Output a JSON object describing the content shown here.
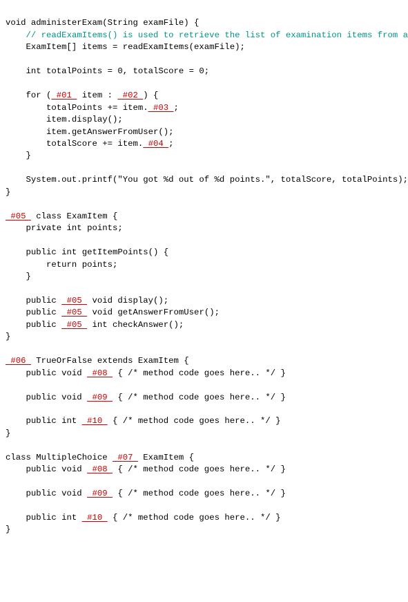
{
  "blanks": {
    "b01": " #01 ",
    "b02": " #02 ",
    "b03": " #03 ",
    "b04": " #04 ",
    "b05": " #05 ",
    "b06": " #06 ",
    "b07": " #07 ",
    "b08": " #08 ",
    "b09": " #09 ",
    "b10": " #10 "
  },
  "code": {
    "l00a": "void administerExam(String examFile) {",
    "l01a": "    ",
    "l01b": "// readExamItems() is used to retrieve the list of examination items from a file...",
    "l02a": "    ExamItem[] items = readExamItems(examFile);",
    "l04a": "    int totalPoints = 0, totalScore = 0;",
    "l06a": "    for (",
    "l06b": " item : ",
    "l06c": ") {",
    "l07a": "        totalPoints += item.",
    "l07b": ";",
    "l08a": "        item.display();",
    "l09a": "        item.getAnswerFromUser();",
    "l10a": "        totalScore += item.",
    "l10b": ";",
    "l11a": "    }",
    "l13a": "    System.out.printf(\"You got %d out of %d points.\", totalScore, totalPoints);",
    "l14a": "}",
    "l16a": " class ExamItem {",
    "l17a": "    private int points;",
    "l19a": "    public int getItemPoints() {",
    "l20a": "        return points;",
    "l21a": "    }",
    "l23a": "    public ",
    "l23b": " void display();",
    "l24a": "    public ",
    "l24b": " void getAnswerFromUser();",
    "l25a": "    public ",
    "l25b": " int checkAnswer();",
    "l26a": "}",
    "l28a": " TrueOrFalse extends ExamItem {",
    "l29a": "    public void ",
    "l29b": " { /* method code goes here.. */ }",
    "l31a": "    public void ",
    "l31b": " { /* method code goes here.. */ }",
    "l33a": "    public int ",
    "l33b": " { /* method code goes here.. */ }",
    "l34a": "}",
    "l36a": "class MultipleChoice ",
    "l36b": " ExamItem {",
    "l37a": "    public void ",
    "l37b": " { /* method code goes here.. */ }",
    "l39a": "    public void ",
    "l39b": " { /* method code goes here.. */ }",
    "l41a": "    public int ",
    "l41b": " { /* method code goes here.. */ }",
    "l42a": "}"
  }
}
